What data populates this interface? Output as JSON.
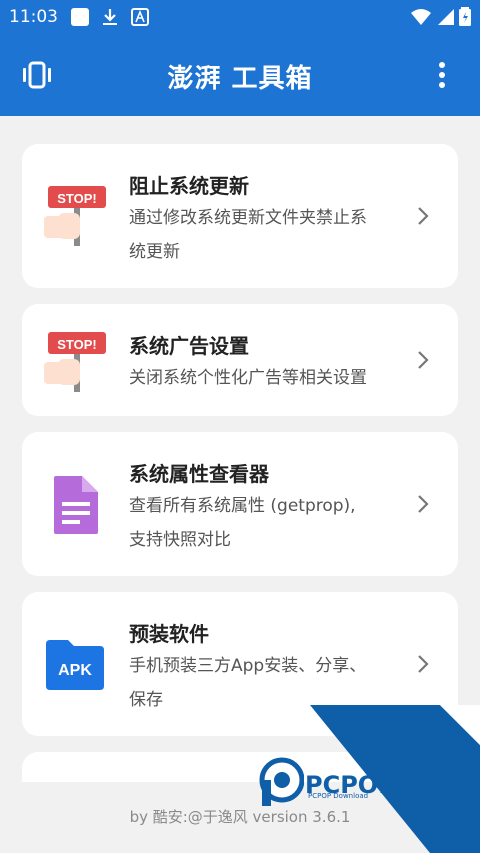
{
  "status_bar": {
    "time": "11:03"
  },
  "app_bar": {
    "title": "澎湃 工具箱",
    "left_icon": "vibration-icon",
    "menu_icon": "more-vert-icon"
  },
  "cards": [
    {
      "title": "阻止系统更新",
      "desc_line1": "通过修改系统更新文件夹禁止系",
      "desc_line2": "统更新",
      "icon": "stop-sign-hand-icon"
    },
    {
      "title": "系统广告设置",
      "desc_line1": "关闭系统个性化广告等相关设置",
      "desc_line2": "",
      "icon": "stop-sign-hand-icon"
    },
    {
      "title": "系统属性查看器",
      "desc_line1": "查看所有系统属性 (getprop),",
      "desc_line2": "支持快照对比",
      "icon": "document-icon"
    },
    {
      "title": "预装软件",
      "desc_line1": "手机预装三方App安装、分享、",
      "desc_line2": "保存",
      "icon": "apk-folder-icon",
      "badge": "APK"
    }
  ],
  "footer": {
    "text": "by 酷安:@于逸风 version 3.6.1"
  },
  "watermark": {
    "text": "PCPOP下载",
    "sub": "PCPOP Download"
  }
}
